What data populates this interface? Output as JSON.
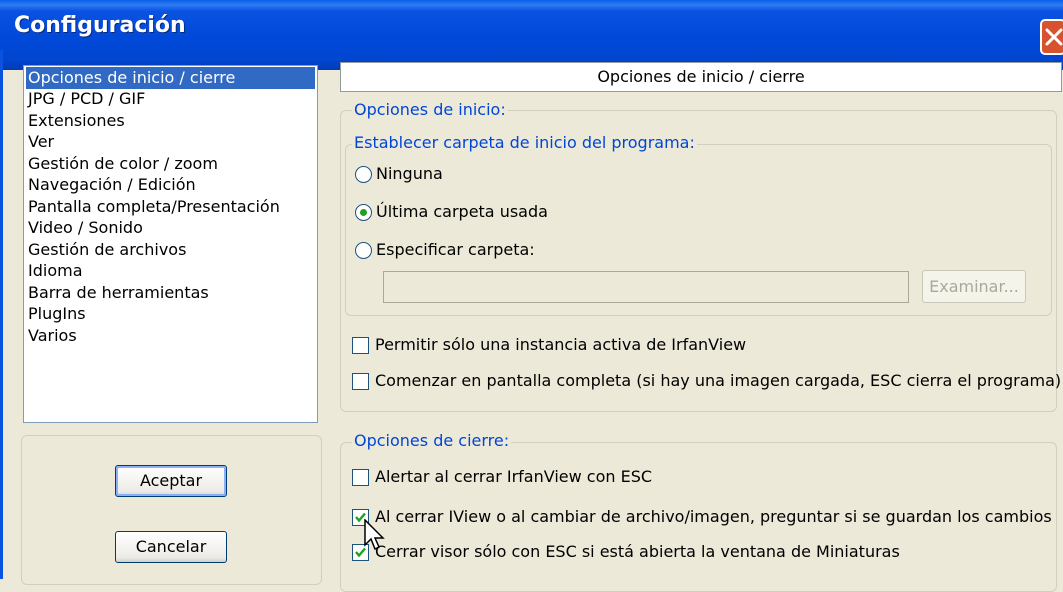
{
  "window": {
    "title": "Configuración"
  },
  "sidebar": {
    "items": [
      "Opciones de inicio / cierre",
      "JPG / PCD / GIF",
      "Extensiones",
      "Ver",
      "Gestión de color / zoom",
      "Navegación / Edición",
      "Pantalla completa/Presentación",
      "Video / Sonido",
      "Gestión de archivos",
      "Idioma",
      "Barra de herramientas",
      "PlugIns",
      "Varios"
    ],
    "selected_index": 0
  },
  "buttons": {
    "accept": "Aceptar",
    "cancel": "Cancelar"
  },
  "panel": {
    "header": "Opciones de inicio / cierre",
    "startup": {
      "legend": "Opciones de inicio:",
      "folder_group_legend": "Establecer carpeta de inicio del programa:",
      "radio_none": "Ninguna",
      "radio_last": "Última carpeta usada",
      "radio_specify": "Especificar carpeta:",
      "selected_radio": "radio_last",
      "folder_value": "",
      "browse": "Examinar...",
      "single_instance": "Permitir sólo una instancia activa de IrfanView",
      "single_instance_checked": false,
      "start_fullscreen": "Comenzar en pantalla completa (si hay una imagen cargada, ESC cierra el programa)",
      "start_fullscreen_checked": false
    },
    "close": {
      "legend": "Opciones de cierre:",
      "alert_esc": "Alertar al cerrar IrfanView con ESC",
      "alert_esc_checked": false,
      "ask_save": "Al cerrar IView o al cambiar de archivo/imagen, preguntar si se guardan los cambios",
      "ask_save_checked": true,
      "close_viewer": "Cerrar visor sólo con ESC si está abierta la ventana de Miniaturas",
      "close_viewer_checked": true
    }
  },
  "colors": {
    "titlebar": "#0048d8",
    "selection": "#316ac5",
    "legend": "#0046d5",
    "check": "#21a121"
  }
}
